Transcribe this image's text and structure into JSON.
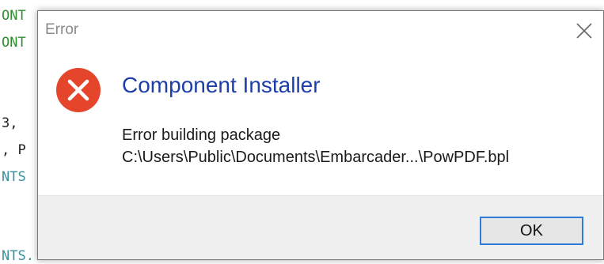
{
  "background_code": [
    {
      "text": "ONT",
      "color": "green"
    },
    {
      "text": "ONT",
      "color": "green"
    },
    {
      "text": "3,",
      "color": "dark"
    },
    {
      "text": ", P",
      "color": "dark"
    },
    {
      "text": "NTS",
      "color": "teal"
    },
    {
      "text": "NTS.",
      "color": "teal"
    }
  ],
  "dialog": {
    "title": "Error",
    "heading": "Component Installer",
    "message_line1": "Error building package",
    "message_line2": "C:\\Users\\Public\\Documents\\Embarcader...\\PowPDF.bpl",
    "ok_label": "OK"
  },
  "colors": {
    "heading": "#1e3fa8",
    "error_icon": "#e5452b",
    "ok_border": "#2f7bd6"
  },
  "icons": {
    "close": "close-icon",
    "error": "error-icon"
  }
}
